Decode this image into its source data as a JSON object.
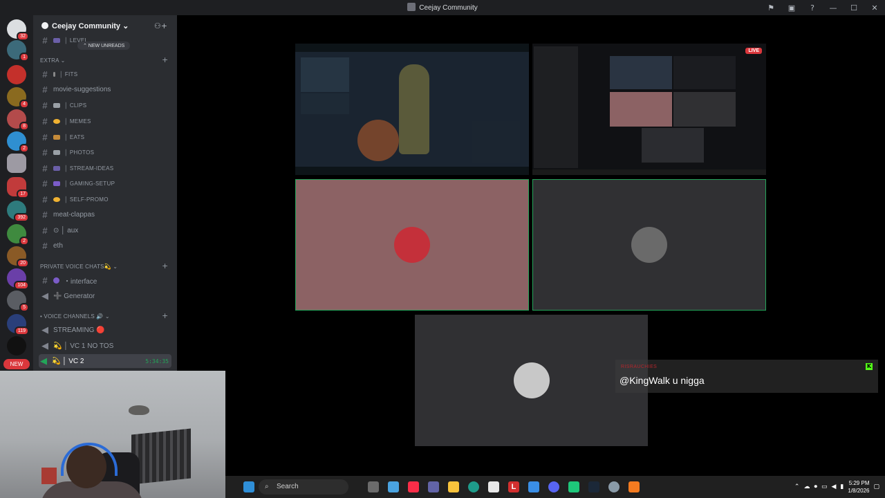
{
  "window": {
    "title": "Ceejay Community",
    "controls": {
      "minimize": "—",
      "maximize": "☐",
      "close": "✕"
    },
    "actions": [
      "inbox-icon",
      "screen-icon",
      "help-icon"
    ]
  },
  "guilds": {
    "badges": [
      "32",
      "1",
      "4",
      "8",
      "2",
      "17",
      "392",
      "2",
      "20",
      "104",
      "5",
      "119"
    ],
    "new_label": "NEW"
  },
  "server": {
    "name": "Ceejay Community ⌄"
  },
  "banner": {
    "new_unreads": "⌃ NEW UNREADS"
  },
  "channels": {
    "top_partial": "│ LEVEL",
    "extra_category": "EXTRA ⌄",
    "extra": [
      {
        "label": "│ FITS",
        "icon_color": "#888888",
        "small": true
      },
      {
        "label": "movie-suggestions",
        "icon_color": "",
        "small": false
      },
      {
        "label": "│ CLIPS",
        "icon_color": "#9aa0a6",
        "small": true
      },
      {
        "label": "│ MEMES",
        "icon_color": "#f0b232",
        "small": true
      },
      {
        "label": "│ EATS",
        "icon_color": "#c58b3a",
        "small": true
      },
      {
        "label": "│ PHOTOS",
        "icon_color": "#9aa0a6",
        "small": true
      },
      {
        "label": "│ STREAM-IDEAS",
        "icon_color": "#6b5fa8",
        "small": true
      },
      {
        "label": "│ GAMING-SETUP",
        "icon_color": "#7b5cc8",
        "small": true
      },
      {
        "label": "│ SELF-PROMO",
        "icon_color": "#f0b232",
        "small": true
      },
      {
        "label": "meat-clappas",
        "icon_color": "",
        "small": false
      },
      {
        "label": "⊙ │ aux",
        "icon_color": "",
        "small": false
      },
      {
        "label": "eth",
        "icon_color": "",
        "small": false
      }
    ],
    "private_category": "PRIVATE VOICE CHATS💫 ⌄",
    "private": [
      {
        "label": "・interface",
        "kind": "text"
      },
      {
        "label": "➕ Generator",
        "kind": "voice"
      }
    ],
    "voice_category": "• VOICE CHANNELS 🔊 ⌄",
    "voice": [
      {
        "label": "STREAMING 🔴",
        "active": false
      },
      {
        "label": "💫 │ VC 1 NO TOS",
        "active": false
      },
      {
        "label": "💫 │ VC 2",
        "active": true,
        "timer": "5:34:35"
      }
    ]
  },
  "stage": {
    "live_label": "LIVE",
    "chat": {
      "username": "RISRAUCHIES",
      "message": "@KingWalk u nigga",
      "badge": "K"
    }
  },
  "taskbar": {
    "search_placeholder": "Search",
    "time": "5:29 PM",
    "date": "1/8/2026",
    "app_letter": "L"
  },
  "colors": {
    "accent_green": "#23a559",
    "alert_red": "#da373c",
    "tile_pink": "#8c6264",
    "tile_dark": "#303033"
  }
}
